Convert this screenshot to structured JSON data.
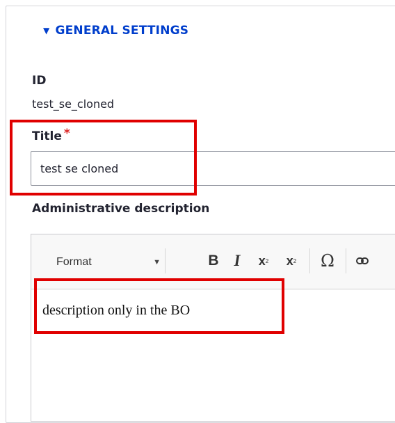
{
  "section": {
    "summary_label": "GENERAL SETTINGS",
    "expanded": true
  },
  "id_field": {
    "label": "ID",
    "value": "test_se_cloned"
  },
  "title_field": {
    "label": "Title",
    "required_mark": "*",
    "value": "test se cloned"
  },
  "description_field": {
    "label": "Administrative description",
    "toolbar": {
      "format_label": "Format",
      "bold": "B",
      "italic": "I",
      "subscript": "x",
      "superscript": "x",
      "special_char": "Ω"
    },
    "content": "description only in the BO"
  },
  "colors": {
    "accent": "#003ecc",
    "required": "#dc2323",
    "highlight": "#e00000"
  }
}
